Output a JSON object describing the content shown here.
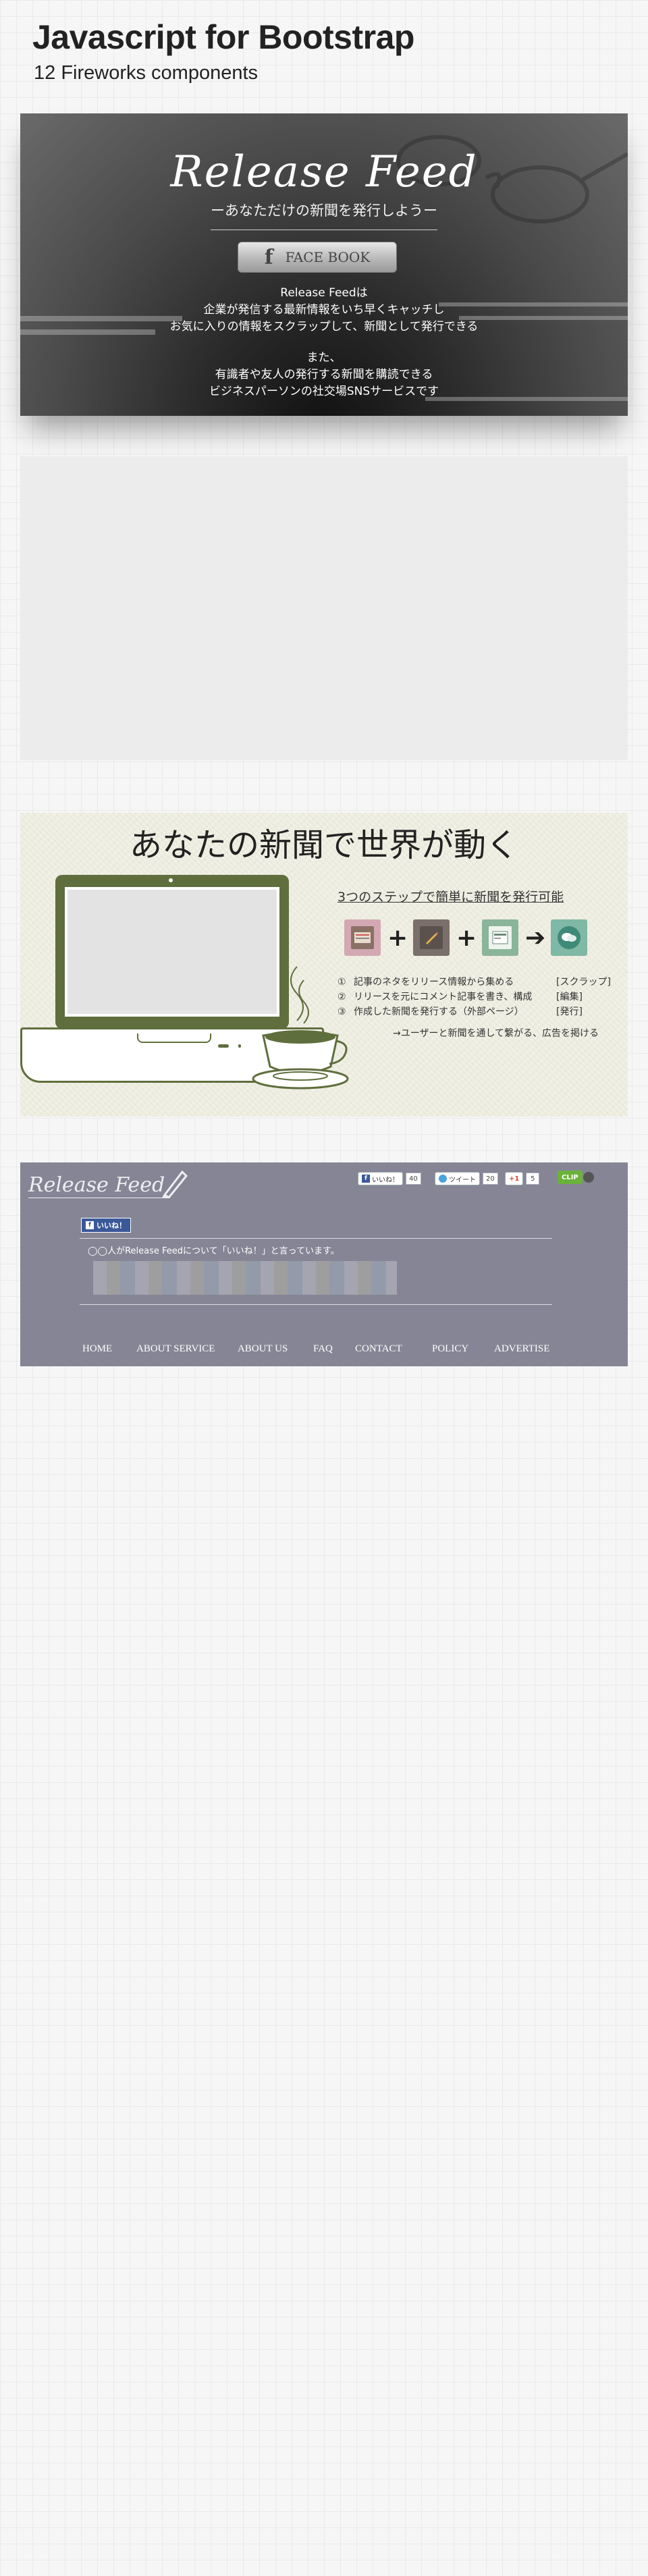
{
  "page": {
    "title": "Javascript for Bootstrap",
    "subtitle": "12 Fireworks components"
  },
  "hero": {
    "logo": "Release Feed",
    "tagline": "ーあなただけの新聞を発行しようー",
    "fb_icon": "f",
    "fb_label": "FACE BOOK",
    "lines": [
      "Release Feedは",
      "企業が発信する最新情報をいち早くキャッチし",
      "お気に入りの情報をスクラップして、新聞として発行できる",
      "また、",
      "有識者や友人の発行する新聞を購読できる",
      "ビジネスパーソンの社交場SNSサービスです"
    ]
  },
  "feature": {
    "heading": "あなたの新聞で世界が動く",
    "steps_title": "3つのステップで簡単に新聞を発行可能",
    "step_icons": [
      "newspaper-icon",
      "pencil-icon",
      "document-icon",
      "speech-bubbles-icon"
    ],
    "step_ops": [
      "+",
      "+",
      "➔"
    ],
    "steps": [
      {
        "num": "①",
        "text": "記事のネタをリリース情報から集める",
        "tag": "[スクラップ]"
      },
      {
        "num": "②",
        "text": "リリースを元にコメント記事を書き、構成",
        "tag": "[編集]"
      },
      {
        "num": "③",
        "text": "作成した新聞を発行する（外部ページ）",
        "tag": "[発行]"
      }
    ],
    "note": "→ユーザーと新聞を通して繋がる、広告を掲ける"
  },
  "footer": {
    "logo": "Release Feed",
    "share": {
      "facebook_label": "いいね！",
      "facebook_count": "40",
      "twitter_label": "ツイート",
      "twitter_count": "20",
      "google_label": "+1",
      "google_count": "5",
      "clip_label": "CLIP"
    },
    "like_button": "いいね！",
    "like_text": "◯◯人がRelease Feedについて「いいね！」と言っています。",
    "nav": [
      "HOME",
      "ABOUT SERVICE",
      "ABOUT US",
      "FAQ",
      "CONTACT",
      "POLICY",
      "ADVERTISE"
    ]
  },
  "colors": {
    "accent_green": "#5f6e3d",
    "footer_bg": "#858596",
    "facebook_blue": "#3b5998"
  }
}
